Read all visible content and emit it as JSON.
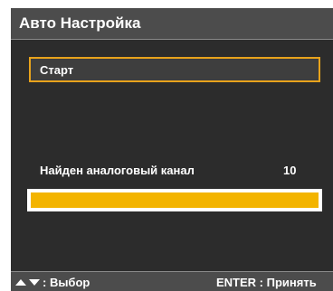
{
  "window": {
    "title": "Авто Настройка"
  },
  "menu": {
    "start_label": "Старт"
  },
  "scan": {
    "found_label": "Найден аналоговый канал",
    "found_count": "10",
    "progress_percent": 100
  },
  "footer": {
    "select_label": ": Выбор",
    "enter_label": "ENTER : Принять"
  },
  "icons": {
    "up": "up-arrow-icon",
    "down": "down-arrow-icon"
  },
  "colors": {
    "background": "#2c2c2c",
    "bar": "#4c4c4c",
    "selection_border": "#e8a31c",
    "progress_fill": "#f3b400",
    "text": "#ffffff"
  }
}
